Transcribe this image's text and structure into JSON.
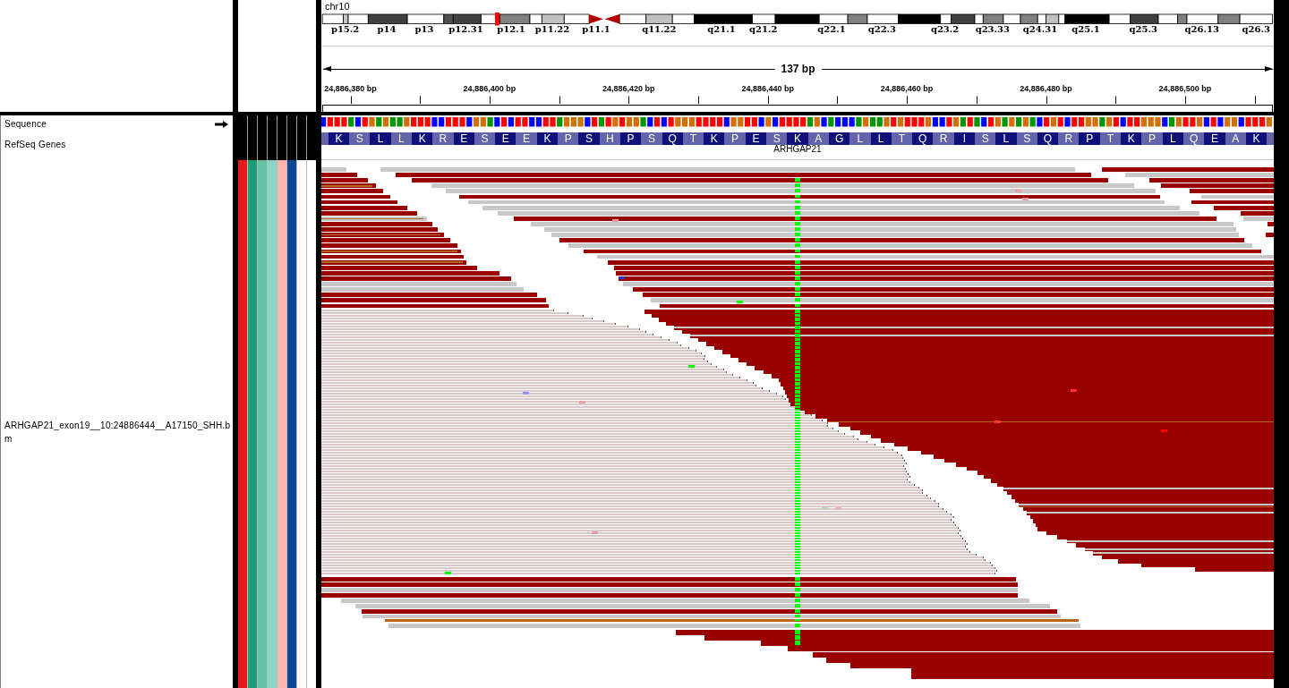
{
  "ideogram": {
    "chromosome": "chr10",
    "bands": [
      "p15.2",
      "p14",
      "p13",
      "p12.31",
      "p12.1",
      "p11.22",
      "p11.1",
      "q11.22",
      "q21.1",
      "q21.2",
      "q22.1",
      "q22.3",
      "q23.2",
      "q23.33",
      "q24.31",
      "q25.1",
      "q25.3",
      "q26.13",
      "q26.3"
    ]
  },
  "ruler": {
    "span": "137 bp",
    "ticks": [
      "24,886,380 bp",
      "24,886,400 bp",
      "24,886,420 bp",
      "24,886,440 bp",
      "24,886,460 bp",
      "24,886,480 bp",
      "24,886,500 bp"
    ]
  },
  "tracks": [
    {
      "kind": "sequence",
      "name": "Sequence"
    },
    {
      "kind": "gene",
      "name": "RefSeq Genes",
      "gene": "ARHGAP21",
      "amino_acids": [
        "K",
        "S",
        "L",
        "L",
        "K",
        "R",
        "E",
        "S",
        "E",
        "E",
        "K",
        "P",
        "S",
        "H",
        "P",
        "S",
        "Q",
        "T",
        "K",
        "P",
        "E",
        "S",
        "K",
        "A",
        "G",
        "L",
        "L",
        "T",
        "Q",
        "R",
        "I",
        "S",
        "L",
        "S",
        "Q",
        "R",
        "P",
        "T",
        "K",
        "P",
        "L",
        "Q",
        "E",
        "A",
        "K"
      ]
    },
    {
      "kind": "alignment",
      "name_lines": [
        "ARHGAP21_exon19__10:24886444__A17150_SHH.b",
        "m"
      ],
      "attributes": [
        {
          "color": "#e41a1c"
        },
        {
          "color": "#1b9e77"
        },
        {
          "color": "#66c2a5"
        },
        {
          "color": "#8dd3c7"
        },
        {
          "color": "#fbb4ae"
        },
        {
          "color": "#0b4596"
        },
        {
          "color": "#ffffff"
        },
        {
          "color": "#ffffff"
        }
      ]
    }
  ]
}
